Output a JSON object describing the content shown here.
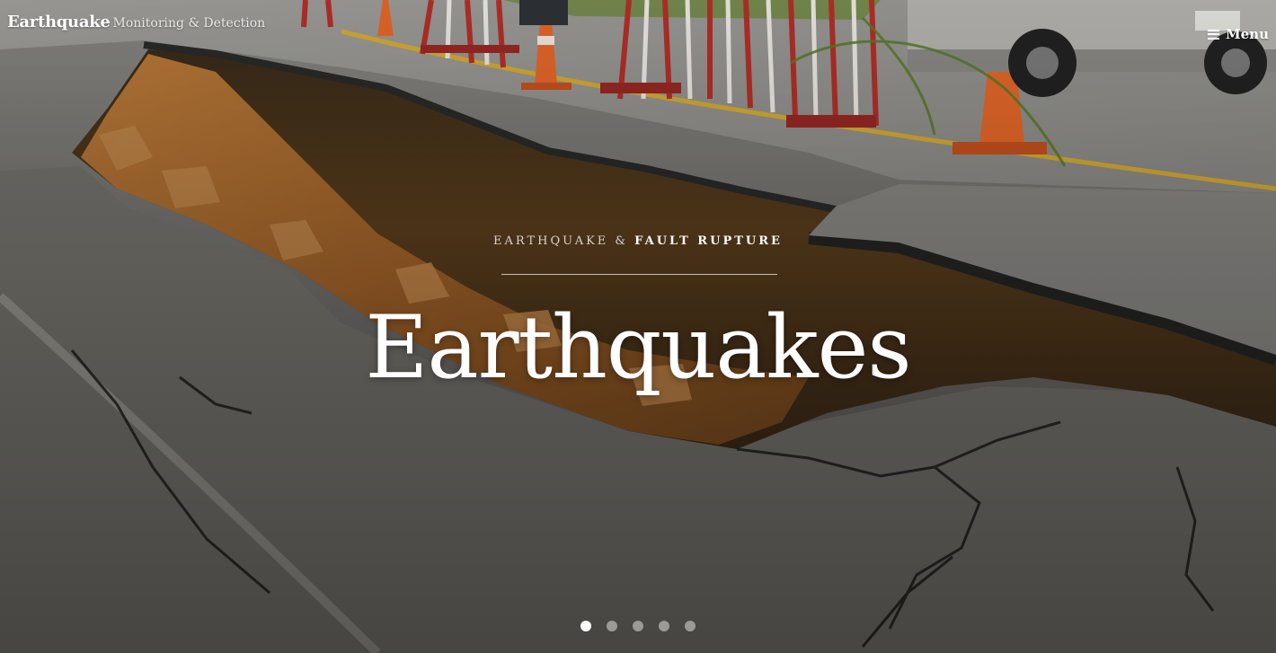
{
  "header": {
    "brand_name": "Earthquake",
    "brand_tagline": "Monitoring & Detection",
    "menu_label": "Menu",
    "menu_icon": "hamburger-icon"
  },
  "hero": {
    "kicker_prefix": "EARTHQUAKE & ",
    "kicker_emphasis": "FAULT RUPTURE",
    "title": "Earthquakes",
    "background": "photo of a cracked asphalt road split by a fault rupture, with traffic barriers and orange cones"
  },
  "slider": {
    "slide_count": 5,
    "active_index": 0
  },
  "colors": {
    "text": "#ffffff",
    "cone_orange": "#ea6a2b",
    "barrier_red": "#b8302a",
    "road_line_yellow": "#e0b22a"
  }
}
